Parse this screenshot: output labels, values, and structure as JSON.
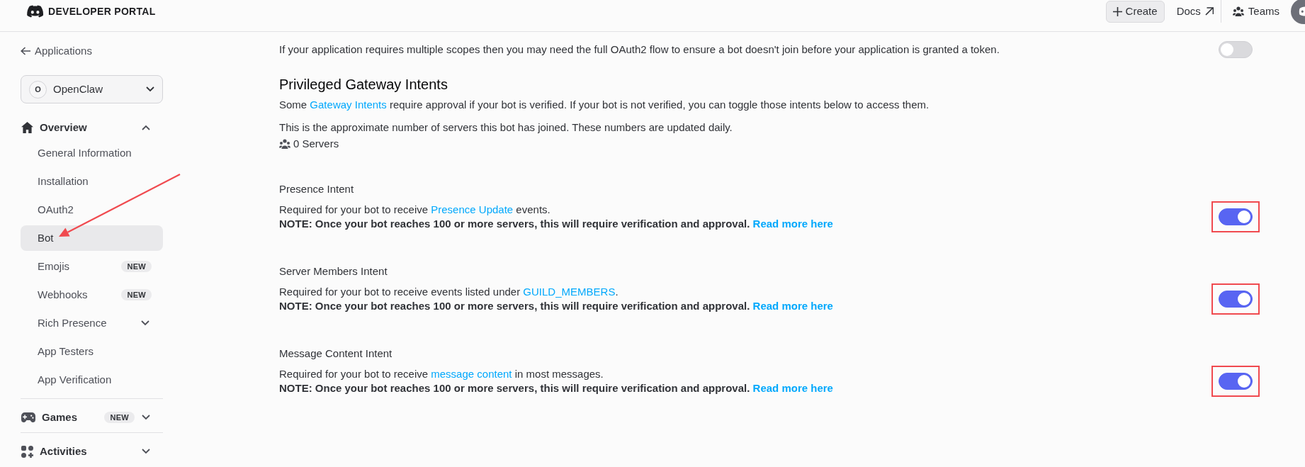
{
  "header": {
    "title": "DEVELOPER PORTAL",
    "actions": [
      {
        "kind": "create",
        "label": "Create"
      },
      {
        "kind": "docs",
        "label": "Docs"
      },
      {
        "kind": "teams",
        "label": "Teams"
      }
    ]
  },
  "sidebar": {
    "back_link": "Applications",
    "app": {
      "initial": "O",
      "name": "OpenClaw"
    },
    "sections": [
      {
        "kind": "overview",
        "label": "Overview",
        "expanded": true,
        "items": [
          {
            "label": "General Information",
            "selected": false,
            "annotated": false
          },
          {
            "label": "Installation",
            "selected": false,
            "annotated": false
          },
          {
            "label": "OAuth2",
            "selected": false,
            "annotated": false
          },
          {
            "label": "Bot",
            "selected": true,
            "annotated": true
          },
          {
            "label": "Emojis",
            "selected": false,
            "annotated": false,
            "badge": "NEW"
          },
          {
            "label": "Webhooks",
            "selected": false,
            "annotated": false,
            "badge": "NEW"
          },
          {
            "label": "Rich Presence",
            "selected": false,
            "annotated": false,
            "expanded": false
          },
          {
            "label": "App Testers",
            "selected": false,
            "annotated": false
          },
          {
            "label": "App Verification",
            "selected": false,
            "annotated": false
          }
        ]
      },
      {
        "kind": "games",
        "label": "Games",
        "badge": "NEW",
        "expanded": false
      },
      {
        "kind": "activities",
        "label": "Activities",
        "expanded": false
      }
    ]
  },
  "oauth2_setting": {
    "description": "If your application requires multiple scopes then you may need the full OAuth2 flow to ensure a bot doesn't join before your application is granted a token.",
    "on": false
  },
  "privileged_intents": {
    "title": "Privileged Gateway Intents",
    "description": [
      {
        "kind": "text",
        "text": "Some "
      },
      {
        "kind": "link",
        "text": "Gateway Intents"
      },
      {
        "kind": "text",
        "text": " require approval if your bot is verified. If your bot is not verified, you can toggle those intents below to access them."
      }
    ],
    "server_note": "This is the approximate number of servers this bot has joined. These numbers are updated daily.",
    "server_count": "0 Servers",
    "intents": [
      {
        "title": "Presence Intent",
        "description": [
          {
            "kind": "text",
            "text": "Required for your bot to receive "
          },
          {
            "kind": "link",
            "text": "Presence Update"
          },
          {
            "kind": "text",
            "text": " events."
          }
        ],
        "note": [
          {
            "kind": "text",
            "text": "NOTE: Once your bot reaches 100 or more servers, this will require verification and approval. "
          },
          {
            "kind": "link",
            "text": "Read more here"
          }
        ],
        "on": true,
        "annotated": true
      },
      {
        "title": "Server Members Intent",
        "description": [
          {
            "kind": "text",
            "text": "Required for your bot to receive events listed under "
          },
          {
            "kind": "link",
            "text": "GUILD_MEMBERS"
          },
          {
            "kind": "text",
            "text": "."
          }
        ],
        "note": [
          {
            "kind": "text",
            "text": "NOTE: Once your bot reaches 100 or more servers, this will require verification and approval. "
          },
          {
            "kind": "link",
            "text": "Read more here"
          }
        ],
        "on": true,
        "annotated": true
      },
      {
        "title": "Message Content Intent",
        "description": [
          {
            "kind": "text",
            "text": "Required for your bot to receive "
          },
          {
            "kind": "link",
            "text": "message content"
          },
          {
            "kind": "text",
            "text": " in most messages."
          }
        ],
        "note": [
          {
            "kind": "text",
            "text": "NOTE: Once your bot reaches 100 or more servers, this will require verification and approval. "
          },
          {
            "kind": "link",
            "text": "Read more here"
          }
        ],
        "on": true,
        "annotated": true
      }
    ]
  }
}
